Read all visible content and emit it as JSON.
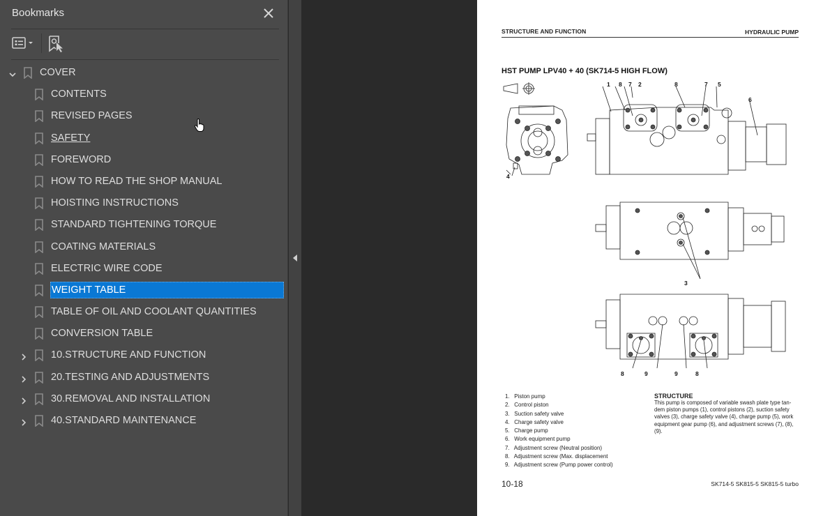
{
  "sidebar": {
    "title": "Bookmarks",
    "close_label": "Close",
    "toolbar": {
      "options_tooltip": "Options",
      "find_tooltip": "Find current bookmark"
    },
    "items": [
      {
        "label": "COVER",
        "level": 0,
        "expandable": true,
        "expanded": true,
        "selected": false,
        "underline": false
      },
      {
        "label": "CONTENTS",
        "level": 1,
        "expandable": false,
        "selected": false,
        "underline": false
      },
      {
        "label": "REVISED PAGES",
        "level": 1,
        "expandable": false,
        "selected": false,
        "underline": false
      },
      {
        "label": "SAFETY",
        "level": 1,
        "expandable": false,
        "selected": false,
        "underline": true
      },
      {
        "label": "FOREWORD",
        "level": 1,
        "expandable": false,
        "selected": false,
        "underline": false
      },
      {
        "label": "HOW TO READ THE SHOP MANUAL",
        "level": 1,
        "expandable": false,
        "selected": false,
        "underline": false
      },
      {
        "label": "HOISTING INSTRUCTIONS",
        "level": 1,
        "expandable": false,
        "selected": false,
        "underline": false
      },
      {
        "label": "STANDARD TIGHTENING TORQUE",
        "level": 1,
        "expandable": false,
        "selected": false,
        "underline": false
      },
      {
        "label": "COATING MATERIALS",
        "level": 1,
        "expandable": false,
        "selected": false,
        "underline": false
      },
      {
        "label": "ELECTRIC WIRE CODE",
        "level": 1,
        "expandable": false,
        "selected": false,
        "underline": false
      },
      {
        "label": "WEIGHT TABLE",
        "level": 1,
        "expandable": false,
        "selected": true,
        "underline": false
      },
      {
        "label": "TABLE OF OIL AND COOLANT QUANTITIES",
        "level": 1,
        "expandable": false,
        "selected": false,
        "underline": false
      },
      {
        "label": "CONVERSION TABLE",
        "level": 1,
        "expandable": false,
        "selected": false,
        "underline": false
      },
      {
        "label": "10.STRUCTURE AND FUNCTION",
        "level": 1,
        "expandable": true,
        "expanded": false,
        "selected": false,
        "underline": false
      },
      {
        "label": "20.TESTING AND ADJUSTMENTS",
        "level": 1,
        "expandable": true,
        "expanded": false,
        "selected": false,
        "underline": false
      },
      {
        "label": "30.REMOVAL AND INSTALLATION",
        "level": 1,
        "expandable": true,
        "expanded": false,
        "selected": false,
        "underline": false
      },
      {
        "label": "40.STANDARD MAINTENANCE",
        "level": 1,
        "expandable": true,
        "expanded": false,
        "selected": false,
        "underline": false
      }
    ]
  },
  "page": {
    "header_left": "STRUCTURE AND FUNCTION",
    "header_right": "HYDRAULIC PUMP",
    "title": "HST PUMP LPV40 + 40 (SK714-5 HIGH FLOW)",
    "figure_callouts": {
      "top_view": [
        "1",
        "8",
        "7",
        "2",
        "8",
        "7",
        "5",
        "6"
      ],
      "end_view": [
        "4"
      ],
      "middle_view": [
        "3"
      ],
      "bottom_view": [
        "8",
        "9",
        "9",
        "8"
      ]
    },
    "parts": [
      {
        "num": "1.",
        "name": "Piston pump"
      },
      {
        "num": "2.",
        "name": "Control piston"
      },
      {
        "num": "3.",
        "name": "Suction safety valve"
      },
      {
        "num": "4.",
        "name": "Charge safety valve"
      },
      {
        "num": "5.",
        "name": "Charge pump"
      },
      {
        "num": "6.",
        "name": "Work equipment pump"
      },
      {
        "num": "7.",
        "name": "Adjustment screw (Neutral position)"
      },
      {
        "num": "8.",
        "name": "Adjustment screw (Max. displacement"
      },
      {
        "num": "9.",
        "name": "Adjustment screw (Pump power control)"
      }
    ],
    "structure_heading": "STRUCTURE",
    "structure_lines": [
      "This pump is composed of variable swash plate type tan-",
      "dem piston pumps (1), control pistons (2), suction safety",
      "valves (3), charge safety valve (4), charge pump (5), work",
      "equipment gear pump (6), and adjustment screws (7), (8),",
      "(9)."
    ],
    "page_number": "10-18",
    "models": "SK714-5  SK815-5  SK815-5 turbo"
  },
  "colors": {
    "sidebar_bg": "#4a4a4a",
    "viewer_bg": "#2a2a2a",
    "selection": "#0a78d4",
    "text": "#dedede"
  }
}
